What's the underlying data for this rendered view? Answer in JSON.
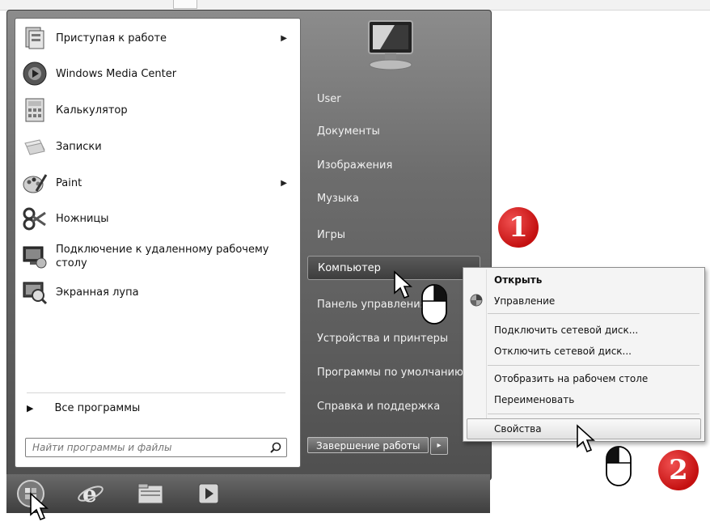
{
  "programs": [
    {
      "label": "Приступая к работе",
      "icon": "getting-started-icon",
      "submenu": true
    },
    {
      "label": "Windows Media Center",
      "icon": "media-center-icon",
      "submenu": false
    },
    {
      "label": "Калькулятор",
      "icon": "calculator-icon",
      "submenu": false
    },
    {
      "label": "Записки",
      "icon": "sticky-notes-icon",
      "submenu": false
    },
    {
      "label": "Paint",
      "icon": "paint-icon",
      "submenu": true
    },
    {
      "label": "Ножницы",
      "icon": "scissors-icon",
      "submenu": false
    },
    {
      "label": "Подключение к удаленному рабочему столу",
      "icon": "remote-desktop-icon",
      "submenu": false
    },
    {
      "label": "Экранная лупа",
      "icon": "magnifier-icon",
      "submenu": false
    }
  ],
  "all_programs_label": "Все программы",
  "search_placeholder": "Найти программы и файлы",
  "right_items": [
    "User",
    "Документы",
    "Изображения",
    "Музыка",
    "Игры",
    "Компьютер",
    "Панель управления",
    "Устройства и принтеры",
    "Программы по умолчанию",
    "Справка и поддержка"
  ],
  "shutdown_label": "Завершение работы",
  "shutdown_arrow": "▸",
  "context_menu": [
    {
      "label": "Открыть",
      "bold": true
    },
    {
      "label": "Управление",
      "icon": "shield-icon"
    },
    {
      "label": "Подключить сетевой диск..."
    },
    {
      "label": "Отключить сетевой диск..."
    },
    {
      "label": "Отобразить на рабочем столе"
    },
    {
      "label": "Переименовать"
    },
    {
      "label": "Свойства",
      "highlighted": true
    }
  ],
  "badges": [
    "1",
    "2"
  ],
  "colors": {
    "badge": "#d42020",
    "panel_dark": "#555555",
    "menu_bg": "#f4f4f4"
  }
}
